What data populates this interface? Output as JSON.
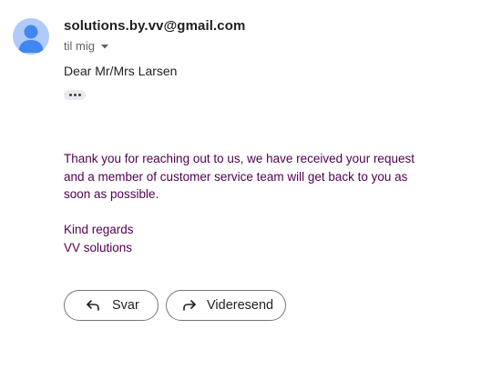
{
  "email": {
    "sender": "solutions.by.vv@gmail.com",
    "recipient": "til mig",
    "greeting": "Dear Mr/Mrs Larsen",
    "body": "Thank you for reaching out to us, we have received your request and a member of customer service team will get back to you as soon as possible.",
    "signoff_line1": "Kind regards",
    "signoff_line2": "VV solutions"
  },
  "actions": {
    "reply_label": "Svar",
    "forward_label": "Videresend"
  },
  "icons": {
    "avatar": "person-icon",
    "recipient_dropdown": "caret-down-icon",
    "expand": "more-horizontal-icon",
    "reply": "reply-arrow-icon",
    "forward": "forward-arrow-icon"
  },
  "colors": {
    "avatar_bg": "#aecbfa",
    "avatar_fg": "#4285f4",
    "quoted_text": "#500050",
    "button_border": "#747775"
  }
}
